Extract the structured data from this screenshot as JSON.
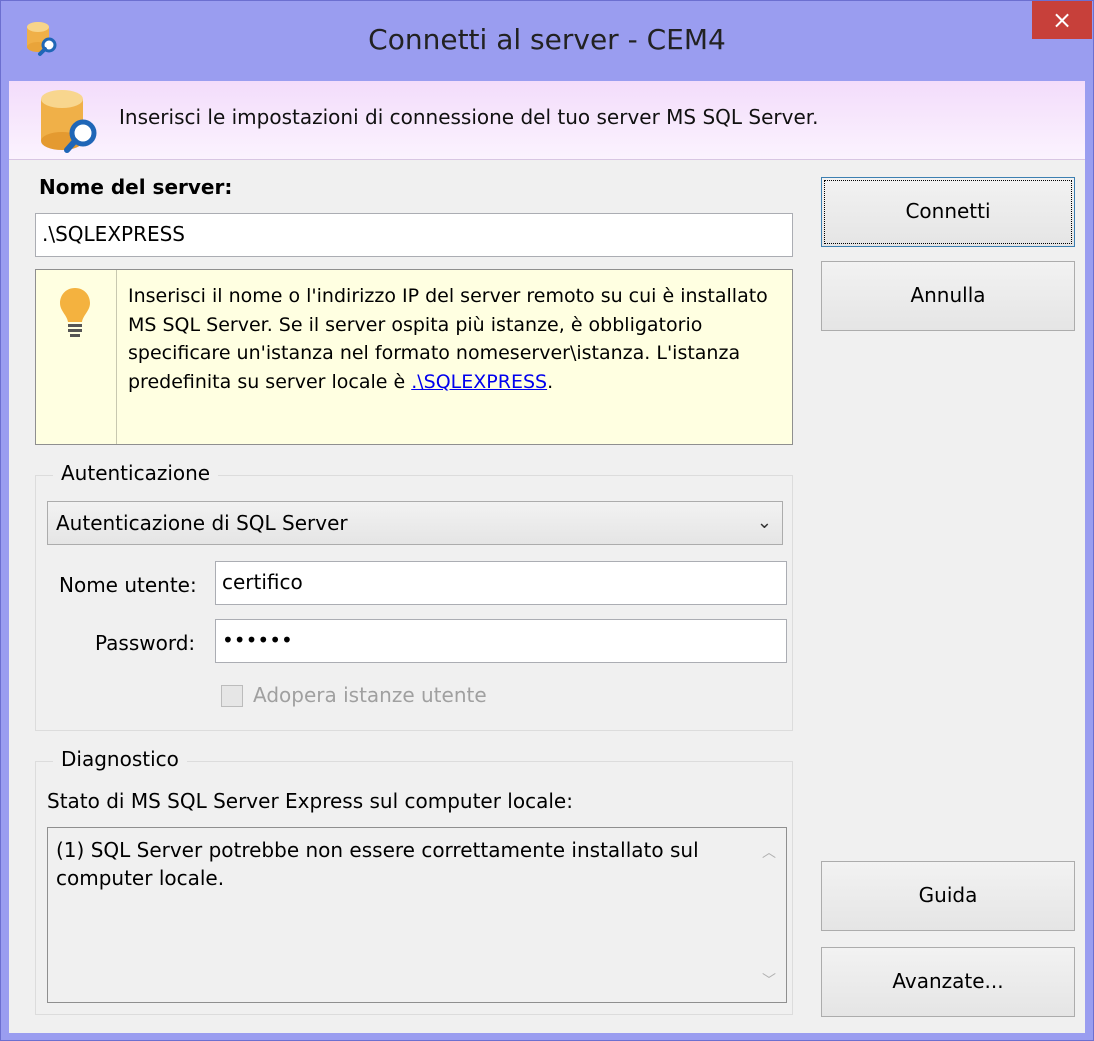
{
  "window": {
    "title": "Connetti al server - CEM4",
    "close_glyph": "×",
    "app_icon": "database-search-icon"
  },
  "banner": {
    "icon": "database-search-icon",
    "text": "Inserisci le impostazioni di connessione del tuo server MS SQL Server."
  },
  "server": {
    "label": "Nome del server:",
    "value": ".\\SQLEXPRESS"
  },
  "hint": {
    "icon": "lightbulb-icon",
    "text": "Inserisci il nome o l'indirizzo IP del server remoto su cui è installato MS SQL Server. Se il server ospita più istanze, è obbligatorio specificare un'istanza nel formato nomeserver\\istanza. L'istanza predefinita su server locale è ",
    "link": ".\\SQLEXPRESS",
    "suffix": "."
  },
  "auth": {
    "group_title": "Autenticazione",
    "mode": "Autenticazione di SQL Server",
    "user_label": "Nome utente:",
    "user_value": "certifico",
    "password_label": "Password:",
    "password_value": "••••••",
    "user_instances_label": "Adopera istanze utente",
    "user_instances_checked": false
  },
  "diagnostics": {
    "group_title": "Diagnostico",
    "status_label": "Stato di MS SQL Server Express sul computer locale:",
    "message": " (1) SQL Server potrebbe non essere correttamente installato sul computer locale."
  },
  "buttons": {
    "connect": "Connetti",
    "cancel": "Annulla",
    "help": "Guida",
    "advanced": "Avanzate..."
  },
  "colors": {
    "banner_gradient_top": "#f3dcfb",
    "hint_background": "#ffffe1",
    "close_button": "#c7403a",
    "link": "#0000ee"
  }
}
